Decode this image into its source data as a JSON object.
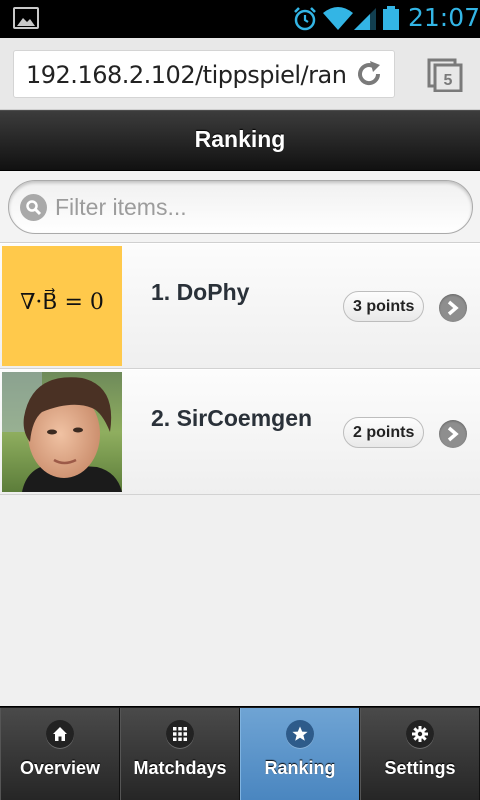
{
  "statusbar": {
    "time": "21:07"
  },
  "browser": {
    "url": "192.168.2.102/tippspiel/rankin",
    "tab_count": "5"
  },
  "header": {
    "title": "Ranking"
  },
  "filter": {
    "placeholder": "Filter items..."
  },
  "ranking": [
    {
      "name": "1. DoPhy",
      "points": "3 points",
      "avatar": "formula-image",
      "formula": "∇·B⃗ = 0"
    },
    {
      "name": "2. SirCoemgen",
      "points": "2 points",
      "avatar": "profile-photo"
    }
  ],
  "navbar": {
    "items": [
      {
        "label": "Overview",
        "icon": "home-icon",
        "active": false
      },
      {
        "label": "Matchdays",
        "icon": "grid-icon",
        "active": false
      },
      {
        "label": "Ranking",
        "icon": "star-icon",
        "active": true
      },
      {
        "label": "Settings",
        "icon": "gear-icon",
        "active": false
      }
    ]
  },
  "colors": {
    "accent": "#33b5e5",
    "active_tab": "#5b95c9",
    "avatar_bg": "#ffc94b"
  }
}
